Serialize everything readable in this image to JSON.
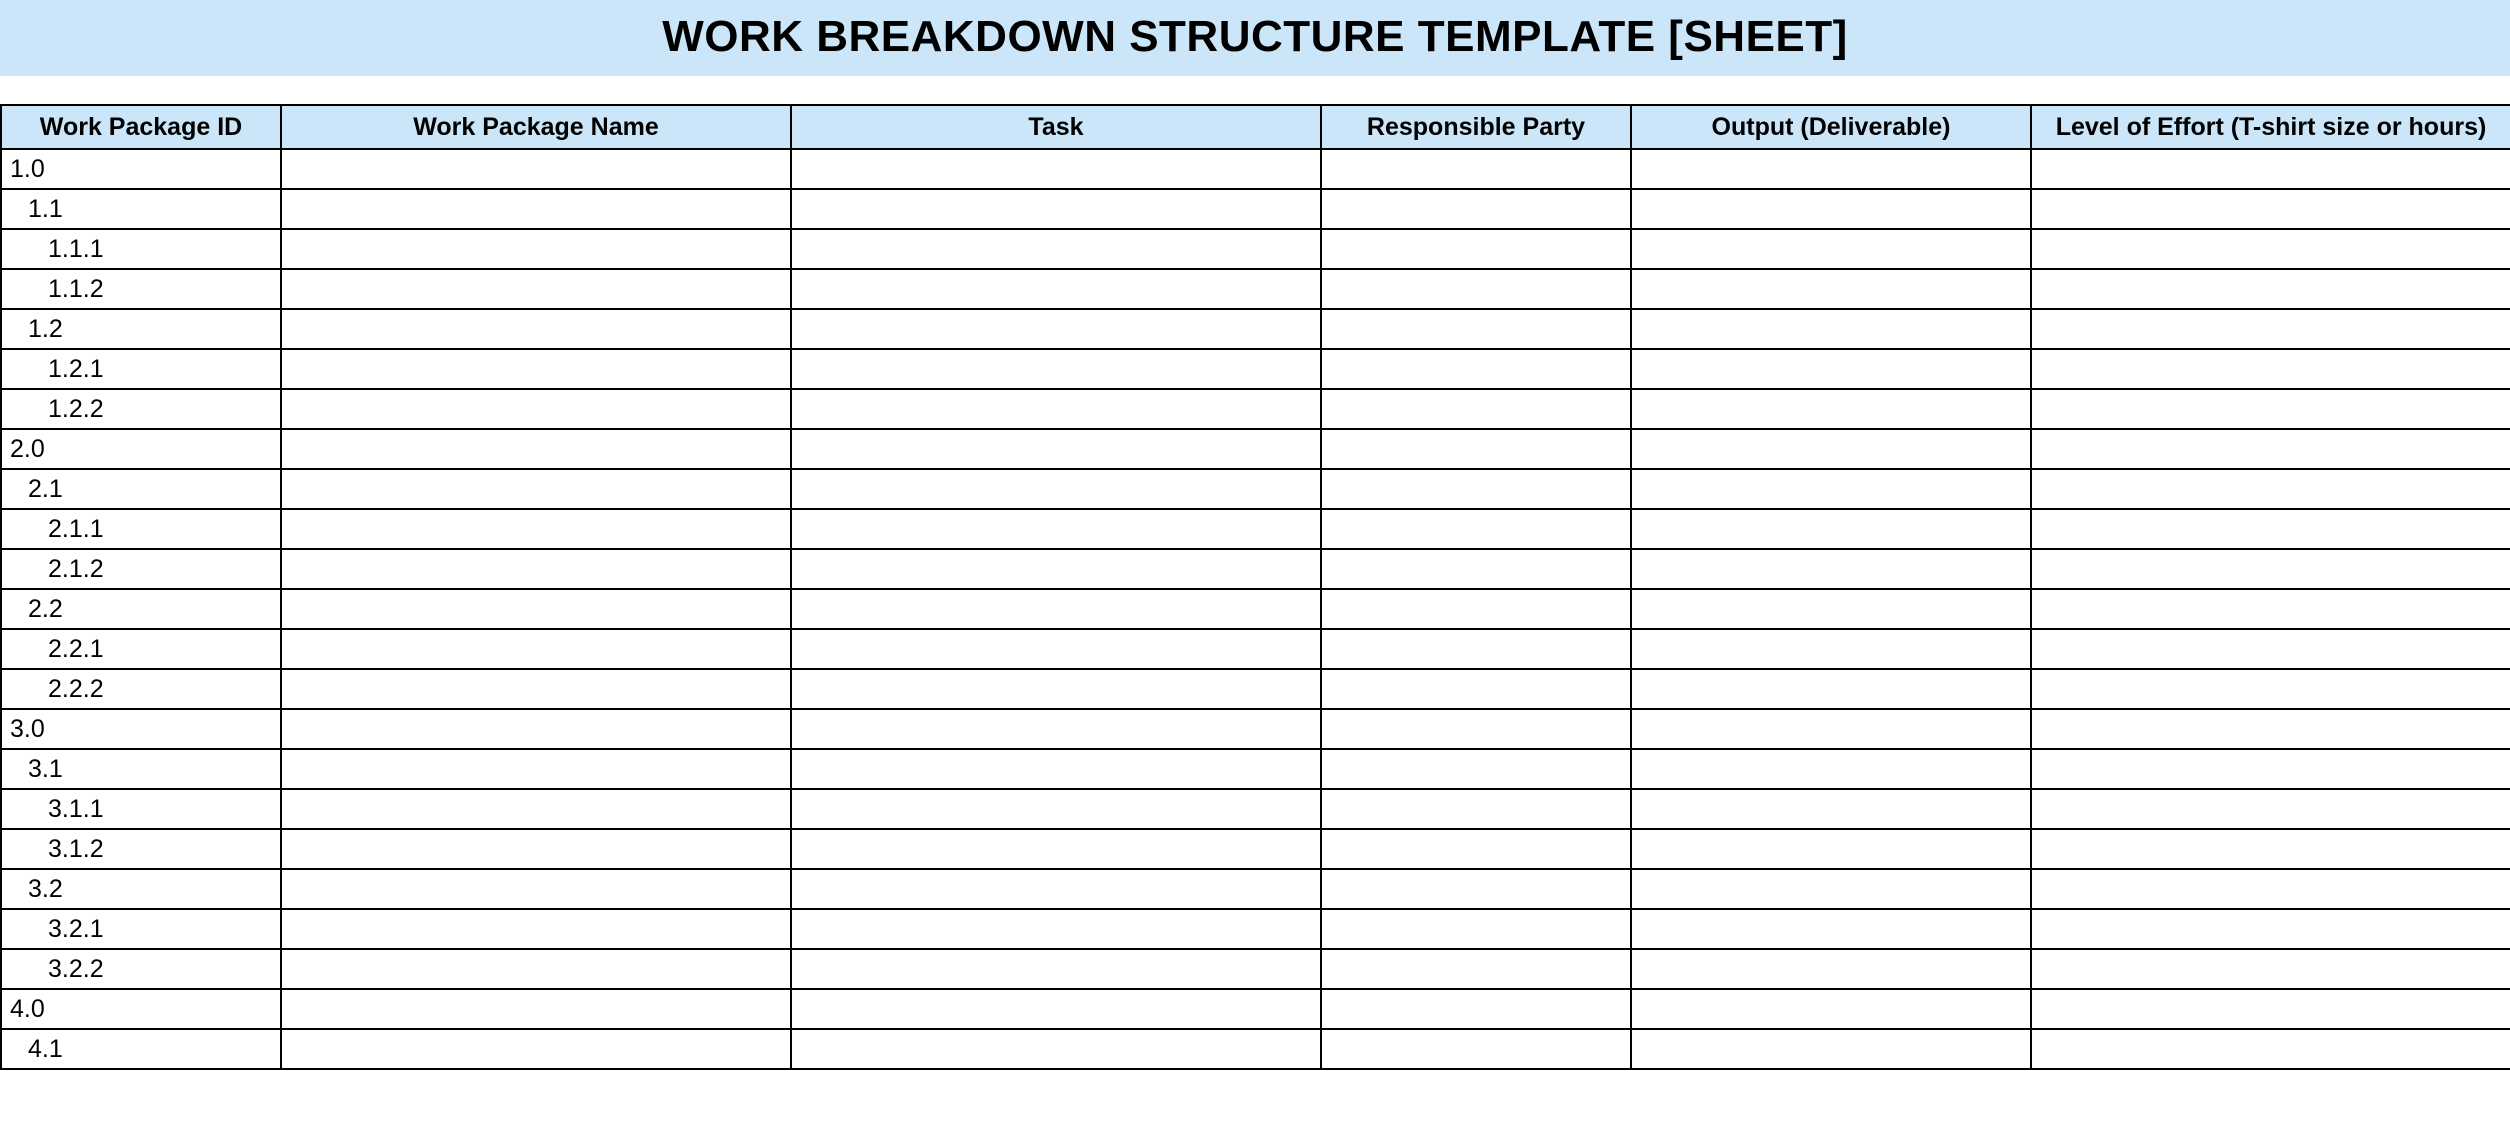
{
  "title": "WORK BREAKDOWN STRUCTURE TEMPLATE [SHEET]",
  "columns": [
    "Work Package ID",
    "Work Package Name",
    "Task",
    "Responsible Party",
    "Output (Deliverable)",
    "Level of Effort (T-shirt size or hours)"
  ],
  "rows": [
    {
      "id": "1.0",
      "indent": 0,
      "name": "",
      "task": "",
      "party": "",
      "output": "",
      "effort": ""
    },
    {
      "id": "1.1",
      "indent": 1,
      "name": "",
      "task": "",
      "party": "",
      "output": "",
      "effort": ""
    },
    {
      "id": "1.1.1",
      "indent": 2,
      "name": "",
      "task": "",
      "party": "",
      "output": "",
      "effort": ""
    },
    {
      "id": "1.1.2",
      "indent": 2,
      "name": "",
      "task": "",
      "party": "",
      "output": "",
      "effort": ""
    },
    {
      "id": "1.2",
      "indent": 1,
      "name": "",
      "task": "",
      "party": "",
      "output": "",
      "effort": ""
    },
    {
      "id": "1.2.1",
      "indent": 2,
      "name": "",
      "task": "",
      "party": "",
      "output": "",
      "effort": ""
    },
    {
      "id": "1.2.2",
      "indent": 2,
      "name": "",
      "task": "",
      "party": "",
      "output": "",
      "effort": ""
    },
    {
      "id": "2.0",
      "indent": 0,
      "name": "",
      "task": "",
      "party": "",
      "output": "",
      "effort": ""
    },
    {
      "id": "2.1",
      "indent": 1,
      "name": "",
      "task": "",
      "party": "",
      "output": "",
      "effort": ""
    },
    {
      "id": "2.1.1",
      "indent": 2,
      "name": "",
      "task": "",
      "party": "",
      "output": "",
      "effort": ""
    },
    {
      "id": "2.1.2",
      "indent": 2,
      "name": "",
      "task": "",
      "party": "",
      "output": "",
      "effort": ""
    },
    {
      "id": "2.2",
      "indent": 1,
      "name": "",
      "task": "",
      "party": "",
      "output": "",
      "effort": ""
    },
    {
      "id": "2.2.1",
      "indent": 2,
      "name": "",
      "task": "",
      "party": "",
      "output": "",
      "effort": ""
    },
    {
      "id": "2.2.2",
      "indent": 2,
      "name": "",
      "task": "",
      "party": "",
      "output": "",
      "effort": ""
    },
    {
      "id": "3.0",
      "indent": 0,
      "name": "",
      "task": "",
      "party": "",
      "output": "",
      "effort": ""
    },
    {
      "id": "3.1",
      "indent": 1,
      "name": "",
      "task": "",
      "party": "",
      "output": "",
      "effort": ""
    },
    {
      "id": "3.1.1",
      "indent": 2,
      "name": "",
      "task": "",
      "party": "",
      "output": "",
      "effort": ""
    },
    {
      "id": "3.1.2",
      "indent": 2,
      "name": "",
      "task": "",
      "party": "",
      "output": "",
      "effort": ""
    },
    {
      "id": "3.2",
      "indent": 1,
      "name": "",
      "task": "",
      "party": "",
      "output": "",
      "effort": ""
    },
    {
      "id": "3.2.1",
      "indent": 2,
      "name": "",
      "task": "",
      "party": "",
      "output": "",
      "effort": ""
    },
    {
      "id": "3.2.2",
      "indent": 2,
      "name": "",
      "task": "",
      "party": "",
      "output": "",
      "effort": ""
    },
    {
      "id": "4.0",
      "indent": 0,
      "name": "",
      "task": "",
      "party": "",
      "output": "",
      "effort": ""
    },
    {
      "id": "4.1",
      "indent": 1,
      "name": "",
      "task": "",
      "party": "",
      "output": "",
      "effort": ""
    }
  ]
}
